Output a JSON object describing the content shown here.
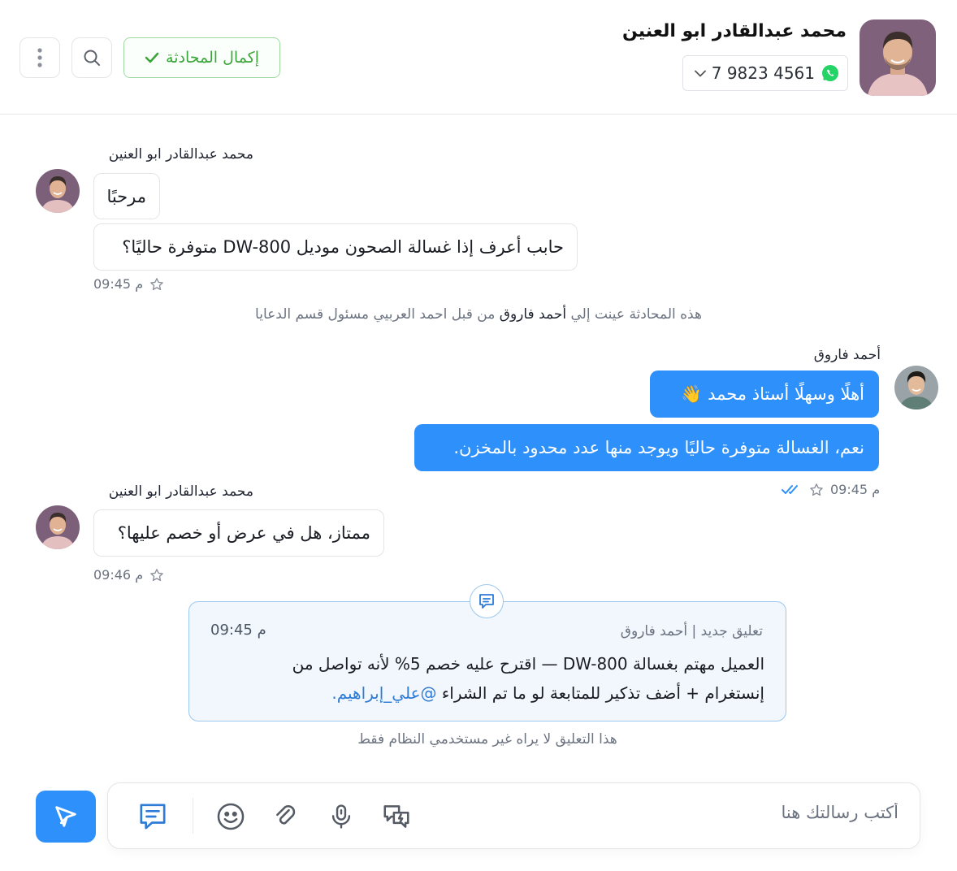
{
  "header": {
    "contact_name": "محمد عبدالقادر ابو العنين",
    "phone": "7 9823 4561",
    "complete_label": "إكمال المحادثة"
  },
  "messages": {
    "customer_name": "محمد عبدالقادر ابو العنين",
    "agent_name": "أحمد فاروق",
    "m1": "مرحبًا",
    "m2": "حابب أعرف إذا غسالة الصحون موديل DW-800 متوفرة حاليًا؟",
    "m1_time": "09:45 م",
    "system_prefix": "هذه المحادثة عينت إلي",
    "system_agent": "أحمد فاروق",
    "system_suffix": "من قبل احمد العربيي مسئول قسم الدعايا",
    "a1": "أهلًا وسهلًا أستاذ محمد 👋",
    "a2": "نعم، الغسالة متوفرة حاليًا ويوجد منها عدد محدود بالمخزن.",
    "a_time": "09:45 م",
    "m3": "ممتاز، هل في عرض أو خصم عليها؟",
    "m3_time": "09:46 م"
  },
  "comment": {
    "header": "تعليق جديد | أحمد فاروق",
    "time": "09:45 م",
    "body": "العميل مهتم بغسالة DW-800 — اقترح عليه خصم 5% لأنه تواصل من إنستغرام + أضف تذكير للمتابعة لو ما تم الشراء",
    "mention": "@علي_إبراهيم.",
    "footer": "هذا التعليق لا يراه غير مستخدمي النظام فقط"
  },
  "composer": {
    "placeholder": "أكتب رسالتك هنا"
  },
  "colors": {
    "accent": "#2e90fa",
    "success": "#3aa63a",
    "whatsapp": "#25d366",
    "comment_bg": "#f1f7fd"
  },
  "icons": [
    "more-vertical-icon",
    "search-icon",
    "check-icon",
    "whatsapp-icon",
    "chevron-down-icon",
    "star-icon",
    "double-check-icon",
    "comment-icon",
    "send-icon",
    "note-icon",
    "emoji-icon",
    "attach-icon",
    "mic-icon",
    "quick-reply-icon"
  ]
}
